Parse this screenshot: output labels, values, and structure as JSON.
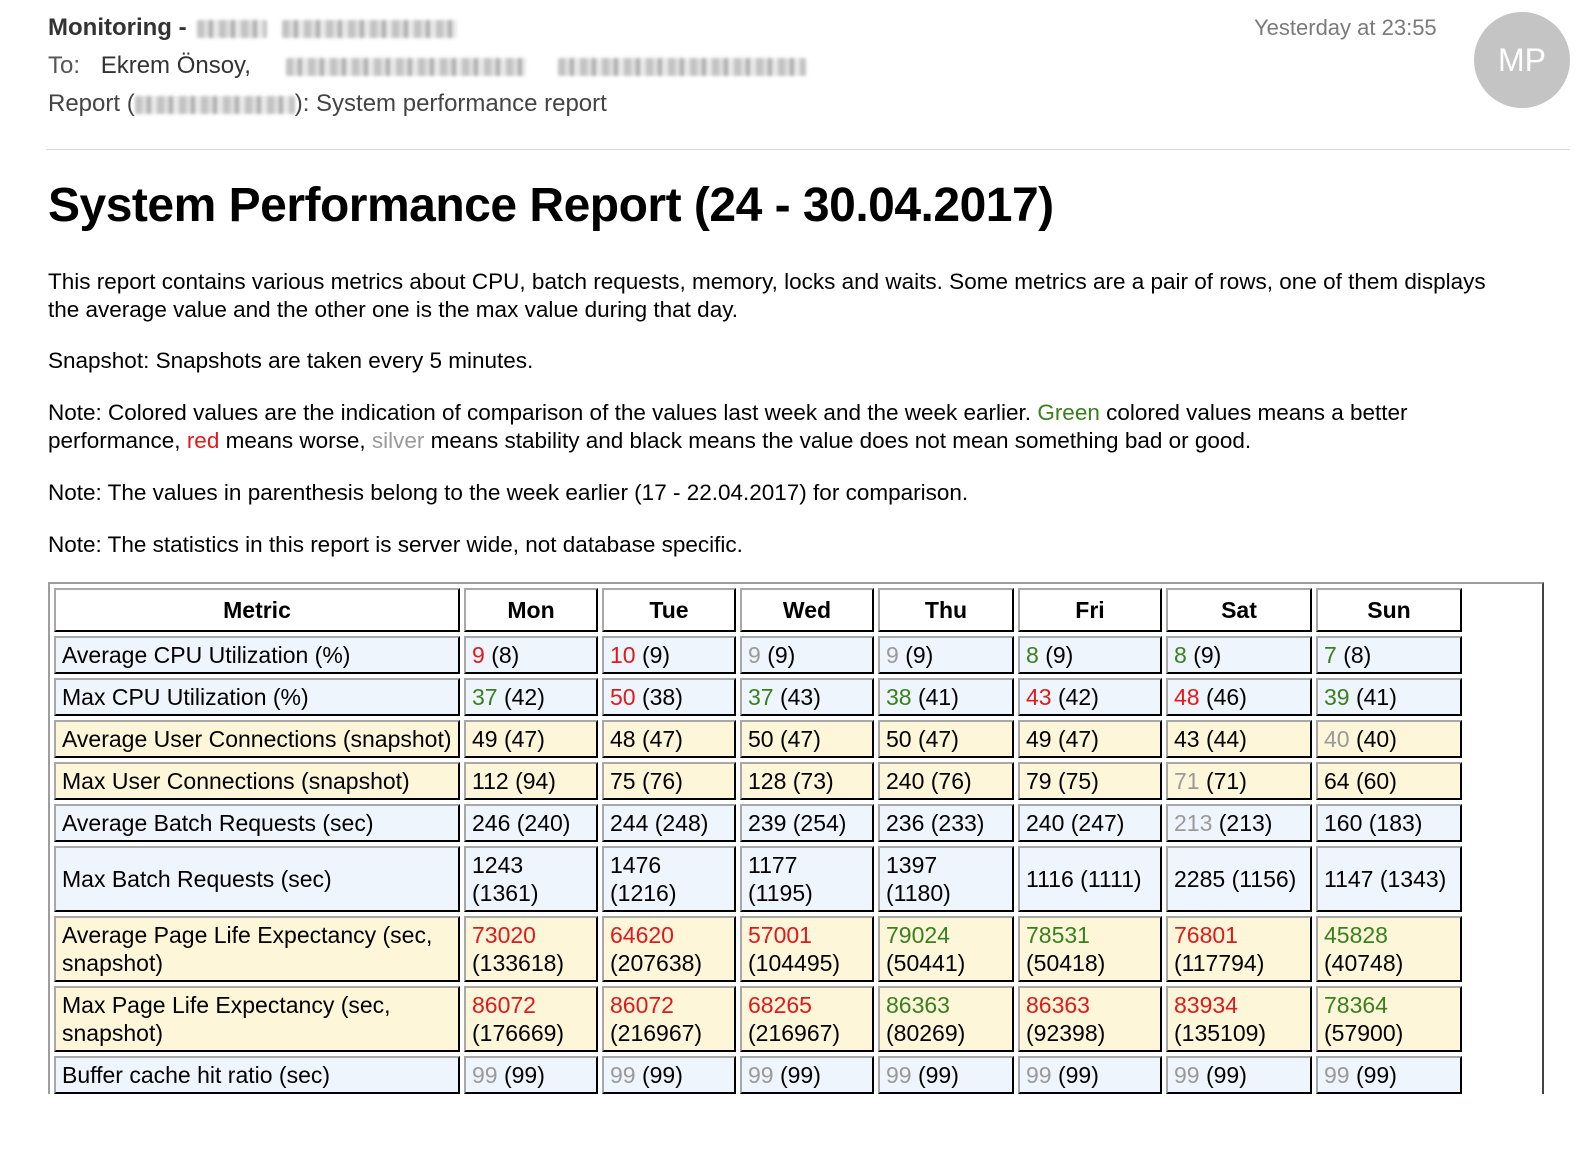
{
  "mail": {
    "from_label": "Monitoring -",
    "to_label": "To:",
    "to_name": "Ekrem Önsoy,",
    "subject_prefix": "Report (",
    "subject_suffix": "): System performance report",
    "timestamp": "Yesterday at 23:55",
    "avatar_initials": "MP"
  },
  "report": {
    "title": "System Performance Report (24 - 30.04.2017)",
    "intro": "This report contains various metrics about CPU, batch requests, memory, locks and waits. Some metrics are a pair of rows, one of them displays the average value and the other one is the max value during that day.",
    "snapshot_note": "Snapshot: Snapshots are taken every 5 minutes.",
    "color_note": {
      "part1": "Note: Colored values are the indication of comparison of the values last week and the week earlier. ",
      "green": "Green",
      "part2": " colored values means a better performance, ",
      "red": "red",
      "part3": " means worse, ",
      "silver": "silver",
      "part4": " means stability and black means the value does not mean something bad or good."
    },
    "parenthesis_note": "Note: The values in parenthesis belong to the week earlier (17 - 22.04.2017) for comparison.",
    "scope_note": "Note: The statistics in this report is server wide, not database specific."
  },
  "colors": {
    "green": "#3a7f1e",
    "red": "#e0191c",
    "silver": "#9a9a9a",
    "row_blue": "#eef5fc",
    "row_yellow": "#fdf6d9"
  },
  "table": {
    "headers": [
      "Metric",
      "Mon",
      "Tue",
      "Wed",
      "Thu",
      "Fri",
      "Sat",
      "Sun"
    ],
    "rows": [
      {
        "metric": "Average CPU Utilization (%)",
        "band": "blue",
        "cells": [
          {
            "cur": "9",
            "prev": "(8)",
            "color": "red"
          },
          {
            "cur": "10",
            "prev": "(9)",
            "color": "red"
          },
          {
            "cur": "9",
            "prev": "(9)",
            "color": "silver"
          },
          {
            "cur": "9",
            "prev": "(9)",
            "color": "silver"
          },
          {
            "cur": "8",
            "prev": "(9)",
            "color": "green"
          },
          {
            "cur": "8",
            "prev": "(9)",
            "color": "green"
          },
          {
            "cur": "7",
            "prev": "(8)",
            "color": "green"
          }
        ]
      },
      {
        "metric": "Max CPU Utilization (%)",
        "band": "blue",
        "cells": [
          {
            "cur": "37",
            "prev": "(42)",
            "color": "green"
          },
          {
            "cur": "50",
            "prev": "(38)",
            "color": "red"
          },
          {
            "cur": "37",
            "prev": "(43)",
            "color": "green"
          },
          {
            "cur": "38",
            "prev": "(41)",
            "color": "green"
          },
          {
            "cur": "43",
            "prev": "(42)",
            "color": "red"
          },
          {
            "cur": "48",
            "prev": "(46)",
            "color": "red"
          },
          {
            "cur": "39",
            "prev": "(41)",
            "color": "green"
          }
        ]
      },
      {
        "metric": "Average User Connections (snapshot)",
        "band": "yellow",
        "cells": [
          {
            "cur": "49",
            "prev": "(47)",
            "color": "black"
          },
          {
            "cur": "48",
            "prev": "(47)",
            "color": "black"
          },
          {
            "cur": "50",
            "prev": "(47)",
            "color": "black"
          },
          {
            "cur": "50",
            "prev": "(47)",
            "color": "black"
          },
          {
            "cur": "49",
            "prev": "(47)",
            "color": "black"
          },
          {
            "cur": "43",
            "prev": "(44)",
            "color": "black"
          },
          {
            "cur": "40",
            "prev": "(40)",
            "color": "silver"
          }
        ]
      },
      {
        "metric": "Max User Connections (snapshot)",
        "band": "yellow",
        "cells": [
          {
            "cur": "112",
            "prev": "(94)",
            "color": "black"
          },
          {
            "cur": "75",
            "prev": "(76)",
            "color": "black"
          },
          {
            "cur": "128",
            "prev": "(73)",
            "color": "black"
          },
          {
            "cur": "240",
            "prev": "(76)",
            "color": "black"
          },
          {
            "cur": "79",
            "prev": "(75)",
            "color": "black"
          },
          {
            "cur": "71",
            "prev": "(71)",
            "color": "silver"
          },
          {
            "cur": "64",
            "prev": "(60)",
            "color": "black"
          }
        ]
      },
      {
        "metric": "Average Batch Requests (sec)",
        "band": "blue",
        "cells": [
          {
            "cur": "246",
            "prev": "(240)",
            "color": "black"
          },
          {
            "cur": "244",
            "prev": "(248)",
            "color": "black"
          },
          {
            "cur": "239",
            "prev": "(254)",
            "color": "black"
          },
          {
            "cur": "236",
            "prev": "(233)",
            "color": "black"
          },
          {
            "cur": "240",
            "prev": "(247)",
            "color": "black"
          },
          {
            "cur": "213",
            "prev": "(213)",
            "color": "silver"
          },
          {
            "cur": "160",
            "prev": "(183)",
            "color": "black"
          }
        ]
      },
      {
        "metric": "Max Batch Requests (sec)",
        "band": "blue",
        "cells": [
          {
            "cur": "1243",
            "prev": "(1361)",
            "color": "black"
          },
          {
            "cur": "1476",
            "prev": "(1216)",
            "color": "black"
          },
          {
            "cur": "1177",
            "prev": "(1195)",
            "color": "black"
          },
          {
            "cur": "1397",
            "prev": "(1180)",
            "color": "black"
          },
          {
            "cur": "1116",
            "prev": "(1111)",
            "color": "black"
          },
          {
            "cur": "2285",
            "prev": "(1156)",
            "color": "black"
          },
          {
            "cur": "1147",
            "prev": "(1343)",
            "color": "black"
          }
        ]
      },
      {
        "metric": "Average Page Life Expectancy (sec, snapshot)",
        "band": "yellow",
        "cells": [
          {
            "cur": "73020",
            "prev": "(133618)",
            "color": "red"
          },
          {
            "cur": "64620",
            "prev": "(207638)",
            "color": "red"
          },
          {
            "cur": "57001",
            "prev": "(104495)",
            "color": "red"
          },
          {
            "cur": "79024",
            "prev": "(50441)",
            "color": "green"
          },
          {
            "cur": "78531",
            "prev": "(50418)",
            "color": "green"
          },
          {
            "cur": "76801",
            "prev": "(117794)",
            "color": "red"
          },
          {
            "cur": "45828",
            "prev": "(40748)",
            "color": "green"
          }
        ]
      },
      {
        "metric": "Max Page Life Expectancy (sec, snapshot)",
        "band": "yellow",
        "cells": [
          {
            "cur": "86072",
            "prev": "(176669)",
            "color": "red"
          },
          {
            "cur": "86072",
            "prev": "(216967)",
            "color": "red"
          },
          {
            "cur": "68265",
            "prev": "(216967)",
            "color": "red"
          },
          {
            "cur": "86363",
            "prev": "(80269)",
            "color": "green"
          },
          {
            "cur": "86363",
            "prev": "(92398)",
            "color": "red"
          },
          {
            "cur": "83934",
            "prev": "(135109)",
            "color": "red"
          },
          {
            "cur": "78364",
            "prev": "(57900)",
            "color": "green"
          }
        ]
      },
      {
        "metric": "Buffer cache hit ratio (sec)",
        "band": "blue",
        "cells": [
          {
            "cur": "99",
            "prev": "(99)",
            "color": "silver"
          },
          {
            "cur": "99",
            "prev": "(99)",
            "color": "silver"
          },
          {
            "cur": "99",
            "prev": "(99)",
            "color": "silver"
          },
          {
            "cur": "99",
            "prev": "(99)",
            "color": "silver"
          },
          {
            "cur": "99",
            "prev": "(99)",
            "color": "silver"
          },
          {
            "cur": "99",
            "prev": "(99)",
            "color": "silver"
          },
          {
            "cur": "99",
            "prev": "(99)",
            "color": "silver"
          }
        ]
      }
    ]
  }
}
